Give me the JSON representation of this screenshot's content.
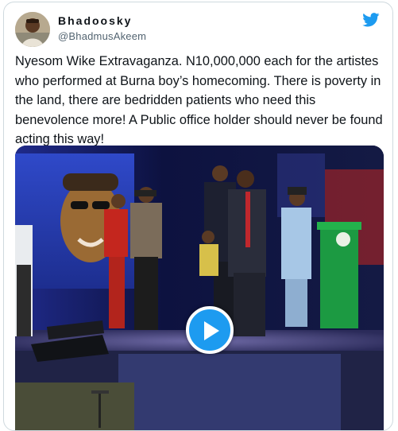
{
  "tweet": {
    "author": {
      "display_name": "Bhadoosky",
      "handle": "@BhadmusAkeem"
    },
    "text": "Nyesom Wike Extravaganza. N10,000,000 each for the artistes who performed at Burna boy’s homecoming. There is poverty in the land, there are bedridden patients who need this benevolence more! A Public office holder should never be found acting this way!",
    "media": {
      "type": "video",
      "play_icon": "play-icon"
    }
  },
  "brand": {
    "icon": "twitter-bird-icon",
    "color": "#1d9bf0"
  },
  "colors": {
    "text": "#0f1419",
    "secondary_text": "#536471",
    "border": "#cfd9de",
    "play_button": "#1d9bf0"
  }
}
